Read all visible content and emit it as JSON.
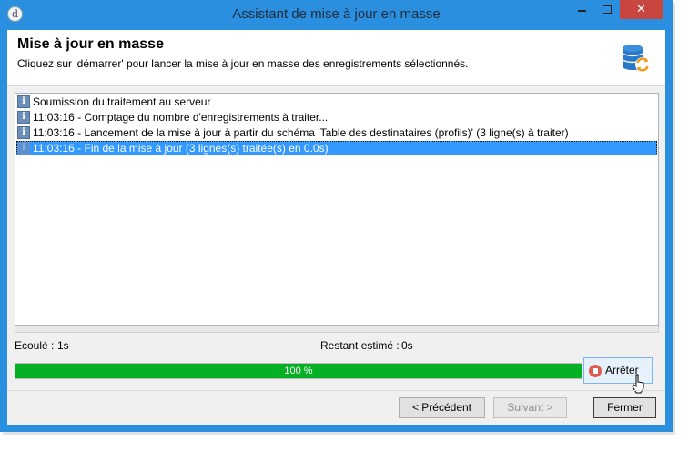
{
  "window": {
    "title": "Assistant de mise à jour en masse",
    "close_glyph": "✕",
    "app_icon_glyph": "d"
  },
  "header": {
    "title": "Mise à jour en masse",
    "subtitle": "Cliquez sur 'démarrer' pour lancer la mise à jour en masse des enregistrements sélectionnés.",
    "icon": "database-refresh-icon"
  },
  "log": {
    "entries": [
      {
        "icon": "info-icon",
        "text": "Soumission du traitement au serveur"
      },
      {
        "icon": "info-icon",
        "text": "11:03:16 - Comptage du nombre d'enregistrements à traiter..."
      },
      {
        "icon": "info-icon",
        "text": "11:03:16 - Lancement de la mise à jour à partir du schéma 'Table des destinataires (profils)' (3 ligne(s) à traiter)"
      },
      {
        "icon": "info-icon",
        "text": "11:03:16 - Fin de la mise à jour (3 lignes(s) traitée(s) en 0.0s)",
        "selected": true
      }
    ]
  },
  "status": {
    "elapsed_label": "Ecoulé :",
    "elapsed_value": "1s",
    "remaining_label": "Restant estimé :",
    "remaining_value": "0s"
  },
  "progress": {
    "percent": 100,
    "text": "100 %",
    "color": "#06b025"
  },
  "stop_button": {
    "label": "Arrêter"
  },
  "footer": {
    "previous_label": "< Précédent",
    "next_label": "Suivant >",
    "close_label": "Fermer"
  },
  "colors": {
    "titlebar": "#2b8fe0",
    "close_button": "#c7463f",
    "selection": "#3399ff"
  }
}
